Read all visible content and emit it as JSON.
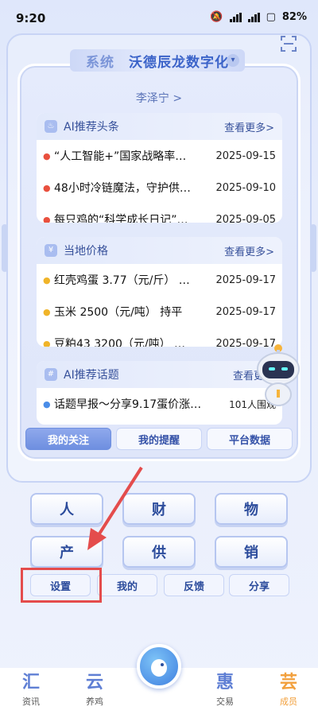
{
  "status_bar": {
    "time": "9:20",
    "network1": "5G",
    "network2": "5G",
    "battery": "82%"
  },
  "header": {
    "system_text": "系统",
    "org_name": "沃德辰龙数字化",
    "user_name": "李泽宁 >"
  },
  "news_card": {
    "title": "AI推荐头条",
    "more": "查看更多>",
    "items": [
      {
        "text": "“人工智能+”国家战略率…",
        "date": "2025-09-15"
      },
      {
        "text": "48小时冷链魔法，守护供…",
        "date": "2025-09-10"
      },
      {
        "text": "每只鸡的“科学成长日记”…",
        "date": "2025-09-05"
      }
    ]
  },
  "price_card": {
    "title": "当地价格",
    "more": "查看更多>",
    "items": [
      {
        "text": "红壳鸡蛋 3.77（元/斤） …",
        "date": "2025-09-17"
      },
      {
        "text": "玉米 2500（元/吨） 持平",
        "date": "2025-09-17"
      },
      {
        "text": "豆粕43 3200（元/吨） …",
        "date": "2025-09-17"
      }
    ]
  },
  "topic_card": {
    "title": "AI推荐话题",
    "more": "查看更多",
    "items": [
      {
        "text": "话题早报～分享9.17蛋价涨…",
        "count": "101人围观"
      }
    ]
  },
  "sub_tabs": [
    "我的关注",
    "我的提醒",
    "平台数据"
  ],
  "grid": {
    "big": [
      "人",
      "财",
      "物",
      "产",
      "供",
      "销"
    ],
    "small": [
      "设置",
      "我的",
      "反馈",
      "分享"
    ]
  },
  "bottom_nav": [
    {
      "glyph": "汇",
      "label": "资讯"
    },
    {
      "glyph": "云",
      "label": "养鸡"
    },
    {
      "glyph": "惠",
      "label": "交易"
    },
    {
      "glyph": "芸",
      "label": "成员"
    }
  ],
  "colors": {
    "accent": "#3b63c9",
    "active_nav": "#f2a03d",
    "annotation": "#e44c4c"
  }
}
